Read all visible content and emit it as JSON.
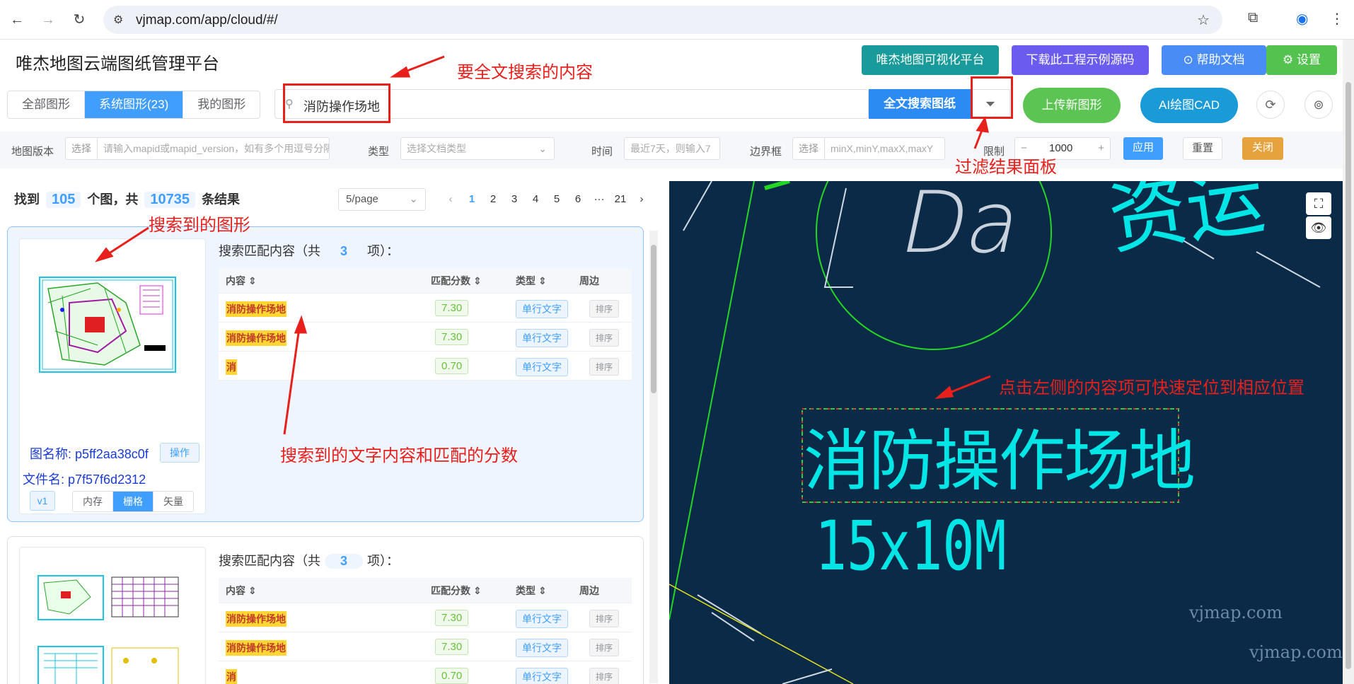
{
  "browser": {
    "url": "vjmap.com/app/cloud/#/"
  },
  "app": {
    "title": "唯杰地图云端图纸管理平台",
    "header_buttons": [
      {
        "label": "唯杰地图可视化平台",
        "color": "#1a9b9b"
      },
      {
        "label": "下载此工程示例源码",
        "color": "#6b5cf0"
      },
      {
        "label": "帮助文档",
        "color": "#4a8cf5"
      },
      {
        "label": "设置",
        "color": "#53c24e"
      }
    ]
  },
  "tabs": [
    {
      "label": "全部图形",
      "active": false
    },
    {
      "label": "系统图形(23)",
      "active": true
    },
    {
      "label": "我的图形",
      "active": false
    }
  ],
  "search": {
    "query": "消防操作场地",
    "search_button": "全文搜索图纸",
    "filter_icon": "funnel-icon"
  },
  "actions": {
    "upload": "上传新图形",
    "ai_cad": "AI绘图CAD"
  },
  "filter": {
    "map_version_label": "地图版本",
    "select_label": "选择",
    "map_version_placeholder": "请输入mapid或mapid_version，如有多个用逗号分隔",
    "type_label": "类型",
    "type_placeholder": "选择文档类型",
    "time_label": "时间",
    "time_placeholder": "最近7天，则输入7",
    "bbox_label": "边界框",
    "bbox_placeholder": "minX,minY,maxX,maxY",
    "limit_label": "限制",
    "limit_value": "1000",
    "apply": "应用",
    "reset": "重置",
    "close": "关闭"
  },
  "results": {
    "found_prefix": "找到",
    "map_count": "105",
    "mid": "个图，共",
    "total": "10735",
    "suffix": "条结果",
    "page_size": "5/page",
    "pages": [
      "1",
      "2",
      "3",
      "4",
      "5",
      "6",
      "···",
      "21"
    ],
    "current_page": "1"
  },
  "match_header": {
    "prefix": "搜索匹配内容（共",
    "suffix": "项）：",
    "col_content": "内容",
    "col_score": "匹配分数",
    "col_type": "类型",
    "col_around": "周边"
  },
  "cards": [
    {
      "match_count": "3",
      "rows": [
        {
          "content": "消防操作场地",
          "score": "7.30",
          "type": "单行文字",
          "action": "排序"
        },
        {
          "content": "消防操作场地",
          "score": "7.30",
          "type": "单行文字",
          "action": "排序"
        },
        {
          "content": "消",
          "score": "0.70",
          "type": "单行文字",
          "action": "排序"
        }
      ],
      "map_name": "图名称: p5ff2aa38c0f",
      "file_name": "文件名: p7f57f6d2312",
      "op": "操作",
      "version": "v1",
      "modes": [
        "内存",
        "栅格",
        "矢量"
      ],
      "active_mode": "栅格"
    },
    {
      "match_count": "3",
      "rows": [
        {
          "content": "消防操作场地",
          "score": "7.30",
          "type": "单行文字",
          "action": "排序"
        },
        {
          "content": "消防操作场地",
          "score": "7.30",
          "type": "单行文字",
          "action": "排序"
        },
        {
          "content": "消",
          "score": "0.70",
          "type": "单行文字",
          "action": "排序"
        }
      ]
    }
  ],
  "map": {
    "main_text": "消防操作场地",
    "sub_text": "15x10M",
    "circle_text": "Da",
    "watermark": "vjmap.com"
  },
  "annotations": {
    "search_content": "要全文搜索的内容",
    "filter_panel": "过滤结果面板",
    "found_figure": "搜索到的图形",
    "found_text": "搜索到的文字内容和匹配的分数",
    "click_locate": "点击左侧的内容项可快速定位到相应位置"
  },
  "colors": {
    "accent": "#409eff",
    "annotation": "#e8201b",
    "map_bg": "#0b2a48",
    "cad_cyan": "#00e5e5"
  }
}
